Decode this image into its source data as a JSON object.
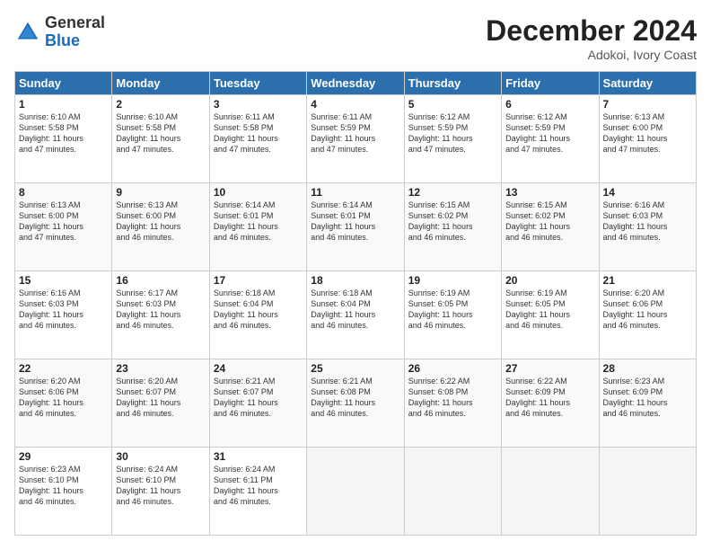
{
  "logo": {
    "general": "General",
    "blue": "Blue"
  },
  "header": {
    "month": "December 2024",
    "location": "Adokoi, Ivory Coast"
  },
  "weekdays": [
    "Sunday",
    "Monday",
    "Tuesday",
    "Wednesday",
    "Thursday",
    "Friday",
    "Saturday"
  ],
  "weeks": [
    [
      {
        "day": "1",
        "info": "Sunrise: 6:10 AM\nSunset: 5:58 PM\nDaylight: 11 hours\nand 47 minutes."
      },
      {
        "day": "2",
        "info": "Sunrise: 6:10 AM\nSunset: 5:58 PM\nDaylight: 11 hours\nand 47 minutes."
      },
      {
        "day": "3",
        "info": "Sunrise: 6:11 AM\nSunset: 5:58 PM\nDaylight: 11 hours\nand 47 minutes."
      },
      {
        "day": "4",
        "info": "Sunrise: 6:11 AM\nSunset: 5:59 PM\nDaylight: 11 hours\nand 47 minutes."
      },
      {
        "day": "5",
        "info": "Sunrise: 6:12 AM\nSunset: 5:59 PM\nDaylight: 11 hours\nand 47 minutes."
      },
      {
        "day": "6",
        "info": "Sunrise: 6:12 AM\nSunset: 5:59 PM\nDaylight: 11 hours\nand 47 minutes."
      },
      {
        "day": "7",
        "info": "Sunrise: 6:13 AM\nSunset: 6:00 PM\nDaylight: 11 hours\nand 47 minutes."
      }
    ],
    [
      {
        "day": "8",
        "info": "Sunrise: 6:13 AM\nSunset: 6:00 PM\nDaylight: 11 hours\nand 47 minutes."
      },
      {
        "day": "9",
        "info": "Sunrise: 6:13 AM\nSunset: 6:00 PM\nDaylight: 11 hours\nand 46 minutes."
      },
      {
        "day": "10",
        "info": "Sunrise: 6:14 AM\nSunset: 6:01 PM\nDaylight: 11 hours\nand 46 minutes."
      },
      {
        "day": "11",
        "info": "Sunrise: 6:14 AM\nSunset: 6:01 PM\nDaylight: 11 hours\nand 46 minutes."
      },
      {
        "day": "12",
        "info": "Sunrise: 6:15 AM\nSunset: 6:02 PM\nDaylight: 11 hours\nand 46 minutes."
      },
      {
        "day": "13",
        "info": "Sunrise: 6:15 AM\nSunset: 6:02 PM\nDaylight: 11 hours\nand 46 minutes."
      },
      {
        "day": "14",
        "info": "Sunrise: 6:16 AM\nSunset: 6:03 PM\nDaylight: 11 hours\nand 46 minutes."
      }
    ],
    [
      {
        "day": "15",
        "info": "Sunrise: 6:16 AM\nSunset: 6:03 PM\nDaylight: 11 hours\nand 46 minutes."
      },
      {
        "day": "16",
        "info": "Sunrise: 6:17 AM\nSunset: 6:03 PM\nDaylight: 11 hours\nand 46 minutes."
      },
      {
        "day": "17",
        "info": "Sunrise: 6:18 AM\nSunset: 6:04 PM\nDaylight: 11 hours\nand 46 minutes."
      },
      {
        "day": "18",
        "info": "Sunrise: 6:18 AM\nSunset: 6:04 PM\nDaylight: 11 hours\nand 46 minutes."
      },
      {
        "day": "19",
        "info": "Sunrise: 6:19 AM\nSunset: 6:05 PM\nDaylight: 11 hours\nand 46 minutes."
      },
      {
        "day": "20",
        "info": "Sunrise: 6:19 AM\nSunset: 6:05 PM\nDaylight: 11 hours\nand 46 minutes."
      },
      {
        "day": "21",
        "info": "Sunrise: 6:20 AM\nSunset: 6:06 PM\nDaylight: 11 hours\nand 46 minutes."
      }
    ],
    [
      {
        "day": "22",
        "info": "Sunrise: 6:20 AM\nSunset: 6:06 PM\nDaylight: 11 hours\nand 46 minutes."
      },
      {
        "day": "23",
        "info": "Sunrise: 6:20 AM\nSunset: 6:07 PM\nDaylight: 11 hours\nand 46 minutes."
      },
      {
        "day": "24",
        "info": "Sunrise: 6:21 AM\nSunset: 6:07 PM\nDaylight: 11 hours\nand 46 minutes."
      },
      {
        "day": "25",
        "info": "Sunrise: 6:21 AM\nSunset: 6:08 PM\nDaylight: 11 hours\nand 46 minutes."
      },
      {
        "day": "26",
        "info": "Sunrise: 6:22 AM\nSunset: 6:08 PM\nDaylight: 11 hours\nand 46 minutes."
      },
      {
        "day": "27",
        "info": "Sunrise: 6:22 AM\nSunset: 6:09 PM\nDaylight: 11 hours\nand 46 minutes."
      },
      {
        "day": "28",
        "info": "Sunrise: 6:23 AM\nSunset: 6:09 PM\nDaylight: 11 hours\nand 46 minutes."
      }
    ],
    [
      {
        "day": "29",
        "info": "Sunrise: 6:23 AM\nSunset: 6:10 PM\nDaylight: 11 hours\nand 46 minutes."
      },
      {
        "day": "30",
        "info": "Sunrise: 6:24 AM\nSunset: 6:10 PM\nDaylight: 11 hours\nand 46 minutes."
      },
      {
        "day": "31",
        "info": "Sunrise: 6:24 AM\nSunset: 6:11 PM\nDaylight: 11 hours\nand 46 minutes."
      },
      null,
      null,
      null,
      null
    ]
  ]
}
